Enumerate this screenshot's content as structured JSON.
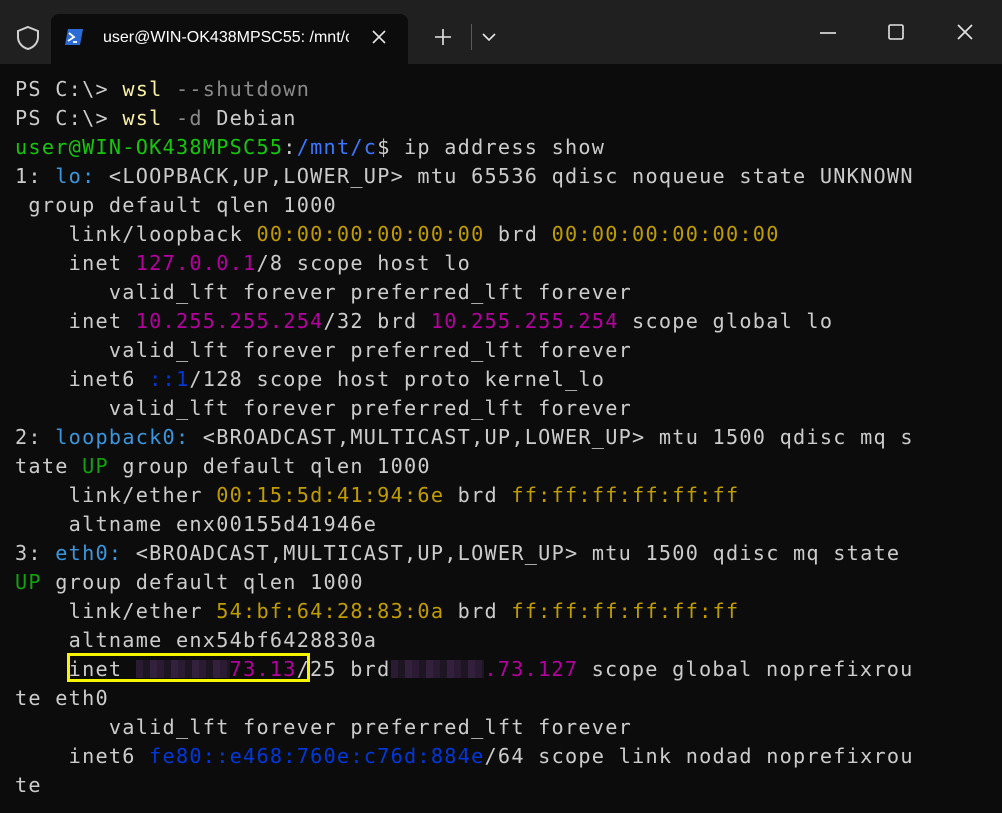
{
  "tab": {
    "title": "user@WIN-OK438MPSC55: /mnt/c",
    "icon": "powershell-icon"
  },
  "titlebar": {
    "icons": [
      "shield-icon",
      "plus-icon",
      "chevron-down-icon",
      "minimize-icon",
      "maximize-icon",
      "close-icon"
    ]
  },
  "colors": {
    "background": "#0c0c0c",
    "titlebar": "#202020",
    "highlight": "#f5f500"
  },
  "terminal": {
    "lines": [
      {
        "segments": [
          {
            "t": "PS C:\\> "
          },
          {
            "t": "wsl",
            "c": "yellow"
          },
          {
            "t": " --shutdown",
            "c": "gray"
          }
        ]
      },
      {
        "segments": [
          {
            "t": "PS C:\\> "
          },
          {
            "t": "wsl",
            "c": "yellow"
          },
          {
            "t": " -d",
            "c": "gray"
          },
          {
            "t": " Debian"
          }
        ]
      },
      {
        "segments": [
          {
            "t": "user@WIN-OK438MPSC55",
            "c": "green"
          },
          {
            "t": ":"
          },
          {
            "t": "/mnt/c",
            "c": "blue"
          },
          {
            "t": "$ ip address show"
          }
        ]
      },
      {
        "segments": [
          {
            "t": "1: "
          },
          {
            "t": "lo:",
            "c": "cyan"
          },
          {
            "t": " <LOOPBACK,UP,LOWER_UP> mtu 65536 qdisc noqueue state UNKNOWN"
          }
        ]
      },
      {
        "segments": [
          {
            "t": " group default qlen 1000"
          }
        ]
      },
      {
        "segments": [
          {
            "t": "    link/loopback "
          },
          {
            "t": "00:00:00:00:00:00",
            "c": "gold"
          },
          {
            "t": " brd "
          },
          {
            "t": "00:00:00:00:00:00",
            "c": "gold"
          }
        ]
      },
      {
        "segments": [
          {
            "t": "    inet "
          },
          {
            "t": "127.0.0.1",
            "c": "purple"
          },
          {
            "t": "/8 scope host lo"
          }
        ]
      },
      {
        "segments": [
          {
            "t": "       valid_lft forever preferred_lft forever"
          }
        ]
      },
      {
        "segments": [
          {
            "t": "    inet "
          },
          {
            "t": "10.255.255.254",
            "c": "purple"
          },
          {
            "t": "/32 brd "
          },
          {
            "t": "10.255.255.254",
            "c": "purple"
          },
          {
            "t": " scope global lo"
          }
        ]
      },
      {
        "segments": [
          {
            "t": "       valid_lft forever preferred_lft forever"
          }
        ]
      },
      {
        "segments": [
          {
            "t": "    inet6 "
          },
          {
            "t": "::1",
            "c": "dark-blue"
          },
          {
            "t": "/128 scope host proto kernel_lo"
          }
        ]
      },
      {
        "segments": [
          {
            "t": "       valid_lft forever preferred_lft forever"
          }
        ]
      },
      {
        "segments": [
          {
            "t": "2: "
          },
          {
            "t": "loopback0:",
            "c": "cyan"
          },
          {
            "t": " <BROADCAST,MULTICAST,UP,LOWER_UP> mtu 1500 qdisc mq s"
          }
        ]
      },
      {
        "segments": [
          {
            "t": "tate "
          },
          {
            "t": "UP",
            "c": "dark-green"
          },
          {
            "t": " group default qlen 1000"
          }
        ]
      },
      {
        "segments": [
          {
            "t": "    link/ether "
          },
          {
            "t": "00:15:5d:41:94:6e",
            "c": "gold"
          },
          {
            "t": " brd "
          },
          {
            "t": "ff:ff:ff:ff:ff:ff",
            "c": "gold"
          }
        ]
      },
      {
        "segments": [
          {
            "t": "    altname enx00155d41946e"
          }
        ]
      },
      {
        "segments": [
          {
            "t": "3: "
          },
          {
            "t": "eth0:",
            "c": "cyan"
          },
          {
            "t": " <BROADCAST,MULTICAST,UP,LOWER_UP> mtu 1500 qdisc mq state"
          }
        ]
      },
      {
        "segments": [
          {
            "t": "UP",
            "c": "dark-green"
          },
          {
            "t": " group default qlen 1000"
          }
        ]
      },
      {
        "segments": [
          {
            "t": "    link/ether "
          },
          {
            "t": "54:bf:64:28:83:0a",
            "c": "gold"
          },
          {
            "t": " brd "
          },
          {
            "t": "ff:ff:ff:ff:ff:ff",
            "c": "gold"
          }
        ]
      },
      {
        "segments": [
          {
            "t": "    altname enx54bf6428830a"
          }
        ]
      },
      {
        "segments": [
          {
            "t": "    inet "
          },
          {
            "redact": 7
          },
          {
            "t": "73.13",
            "c": "purple"
          },
          {
            "t": "/25 brd"
          },
          {
            "redact": 7
          },
          {
            "t": ".73.127",
            "c": "purple"
          },
          {
            "t": " scope global noprefixrou"
          }
        ]
      },
      {
        "segments": [
          {
            "t": "te eth0"
          }
        ]
      },
      {
        "segments": [
          {
            "t": "       valid_lft forever preferred_lft forever"
          }
        ]
      },
      {
        "segments": [
          {
            "t": "    inet6 "
          },
          {
            "t": "fe80::e468:760e:c76d:884e",
            "c": "dark-blue"
          },
          {
            "t": "/64 scope link nodad noprefixrou"
          }
        ]
      },
      {
        "segments": [
          {
            "t": "te"
          }
        ]
      }
    ]
  }
}
